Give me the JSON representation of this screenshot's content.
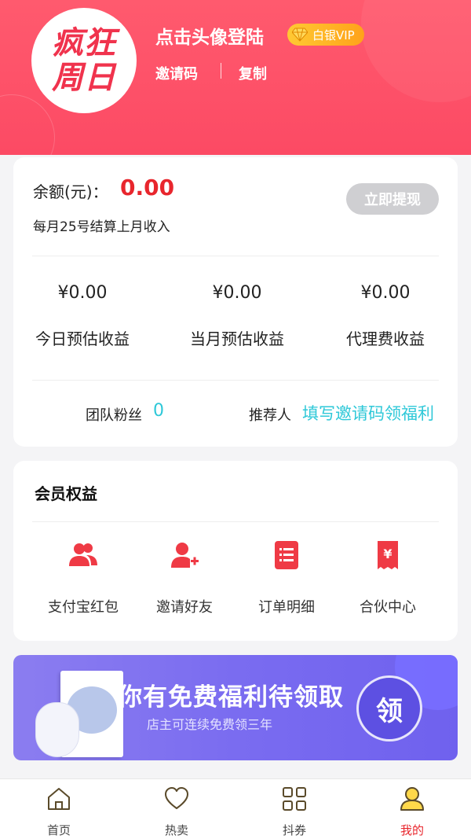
{
  "header": {
    "avatar_logo": [
      "疯狂",
      "周日"
    ],
    "login_title": "点击头像登陆",
    "vip_badge": "白银VIP",
    "invite_code_label": "邀请码",
    "copy_label": "复制"
  },
  "balance": {
    "label": "余额(元)：",
    "value": "0.00",
    "settlement_note": "每月25号结算上月收入",
    "withdraw_button": "立即提现",
    "stats": [
      {
        "amount": "¥0.00",
        "label": "今日预估收益"
      },
      {
        "amount": "¥0.00",
        "label": "当月预估收益"
      },
      {
        "amount": "¥0.00",
        "label": "代理费收益"
      }
    ],
    "team_fans_label": "团队粉丝",
    "team_fans_count": "0",
    "referrer_label": "推荐人",
    "referrer_link": "填写邀请码领福利"
  },
  "membership": {
    "title": "会员权益",
    "items": [
      {
        "label": "支付宝红包",
        "icon": "users-icon"
      },
      {
        "label": "邀请好友",
        "icon": "add-user-icon"
      },
      {
        "label": "订单明细",
        "icon": "list-icon"
      },
      {
        "label": "合伙中心",
        "icon": "yuan-receipt-icon"
      }
    ]
  },
  "banner": {
    "title": "你有免费福利待领取",
    "subtitle": "店主可连续免费领三年",
    "button": "领"
  },
  "nav": {
    "items": [
      {
        "label": "首页",
        "icon": "home-icon"
      },
      {
        "label": "热卖",
        "icon": "heart-icon"
      },
      {
        "label": "抖券",
        "icon": "grid-icon"
      },
      {
        "label": "我的",
        "icon": "user-icon"
      }
    ],
    "active_index": 3
  },
  "colors": {
    "header_red": "#fc4a64",
    "accent_red": "#e8262d",
    "accent_cyan": "#2ec8d8",
    "vip_gold": "#ffb020",
    "banner_purple": "#7a6cf0"
  }
}
